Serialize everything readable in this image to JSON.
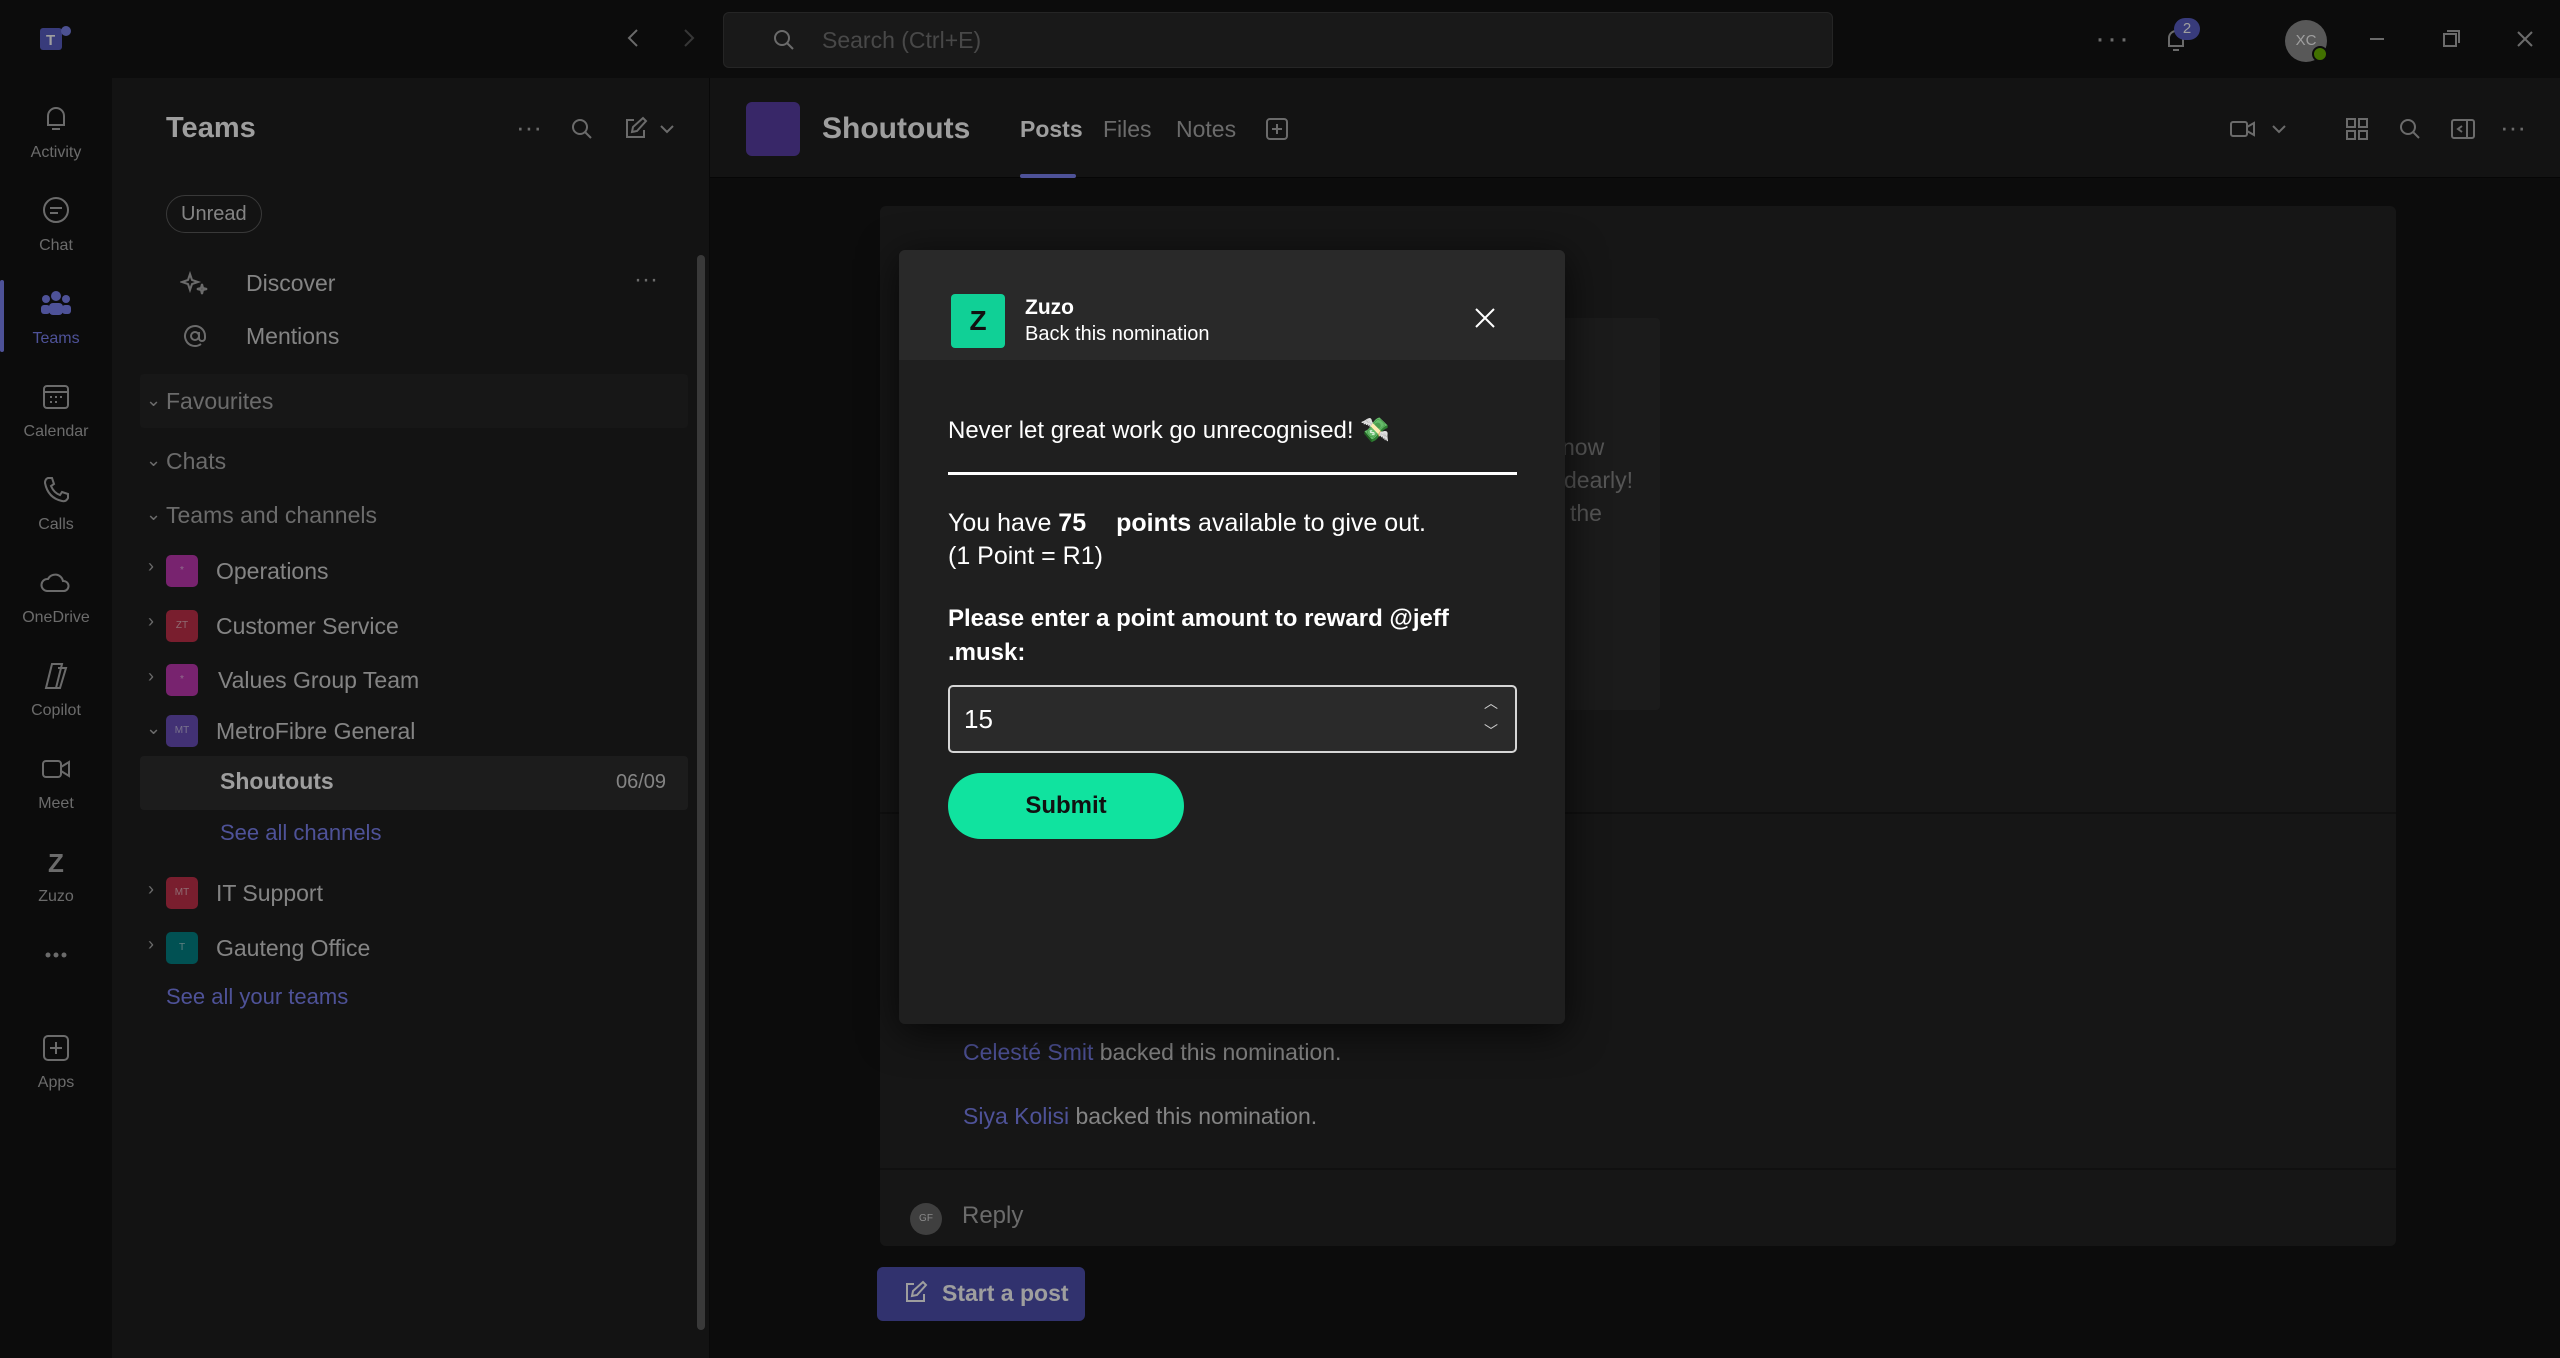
{
  "titlebar": {
    "search_placeholder": "Search (Ctrl+E)",
    "notification_count": "2",
    "avatar_initials": "XC"
  },
  "rail": [
    {
      "label": "Activity",
      "icon": "bell-icon"
    },
    {
      "label": "Chat",
      "icon": "chat-icon"
    },
    {
      "label": "Teams",
      "icon": "teams-icon",
      "active": true
    },
    {
      "label": "Calendar",
      "icon": "calendar-icon"
    },
    {
      "label": "Calls",
      "icon": "phone-icon"
    },
    {
      "label": "OneDrive",
      "icon": "cloud-icon"
    },
    {
      "label": "Copilot",
      "icon": "copilot-icon"
    },
    {
      "label": "Meet",
      "icon": "video-icon"
    },
    {
      "label": "Zuzo",
      "icon": "zuzo-icon"
    },
    {
      "label": "",
      "icon": "more-icon"
    },
    {
      "label": "Apps",
      "icon": "add-apps-icon"
    }
  ],
  "sidebar": {
    "title": "Teams",
    "filter_chip": "Unread",
    "discover": "Discover",
    "mentions": "Mentions",
    "sections": {
      "favourites": "Favourites",
      "chats": "Chats",
      "teams_and_channels": "Teams and channels"
    },
    "teams": [
      {
        "name": "Operations",
        "initials": "*",
        "color": "#c239b3"
      },
      {
        "name": "Customer Service",
        "initials": "ZT",
        "color": "#c4314b"
      },
      {
        "name": "Values Group Team",
        "initials": "*",
        "color": "#c239b3"
      },
      {
        "name": "MetroFibre General",
        "initials": "MT",
        "color": "#6b4fbb"
      },
      {
        "name": "IT Support",
        "initials": "MT",
        "color": "#c4314b"
      },
      {
        "name": "Gauteng Office",
        "initials": "T",
        "color": "#038387"
      }
    ],
    "channel": {
      "name": "Shoutouts",
      "date": "06/09"
    },
    "see_all_channels": "See all channels",
    "see_all_teams": "See all your teams"
  },
  "channel": {
    "title": "Shoutouts",
    "tabs": [
      "Posts",
      "Files",
      "Notes"
    ]
  },
  "post": {
    "fragments": [
      "now",
      "dearly!",
      "the"
    ],
    "activity": [
      {
        "name": "Celesté Smit",
        "text": " backed this nomination."
      },
      {
        "name": "Siya Kolisi",
        "text": " backed this nomination."
      }
    ],
    "reply_avatar": "GF",
    "reply_label": "Reply",
    "start_post": "Start a post"
  },
  "modal": {
    "app_logo_letter": "Z",
    "app_name": "Zuzo",
    "subtitle": "Back this nomination",
    "tagline": "Never let great work go unrecognised! 💸",
    "points_prefix": "You have ",
    "points_value": "75",
    "points_word": "points",
    "points_suffix": " available to give out.",
    "rate": "(1 Point = R1)",
    "prompt": "Please enter a point amount to reward @jeff .musk:",
    "amount_value": "15",
    "submit_label": "Submit"
  }
}
